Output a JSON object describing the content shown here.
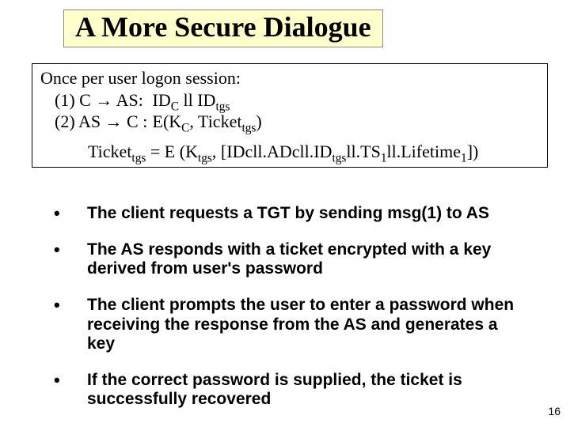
{
  "title": "A More Secure Dialogue",
  "protocol": {
    "header": "Once per user logon session:",
    "line1_label": "(1) C → AS:",
    "line1_body_html": "ID<sub>C</sub> ll ID<sub>tgs</sub>",
    "line2_label": "(2) AS → C :",
    "line2_body_html": "E(K<sub>C</sub>, Ticket<sub>tgs</sub>)",
    "ticket_html": "Ticket<sub>tgs</sub> = E (K<sub>tgs</sub>, [IDcll.ADcll.ID<sub>tgs</sub>ll.TS<sub>1</sub>ll.Lifetime<sub>1</sub>])"
  },
  "bullets": {
    "items": [
      "The client requests a TGT by sending msg(1) to AS",
      "The AS responds with a ticket encrypted with a key derived from user's password",
      "The client prompts the user to enter a password when receiving the response from the AS and generates a key",
      "If the correct password is supplied, the ticket is successfully recovered"
    ]
  },
  "page_number": "16"
}
